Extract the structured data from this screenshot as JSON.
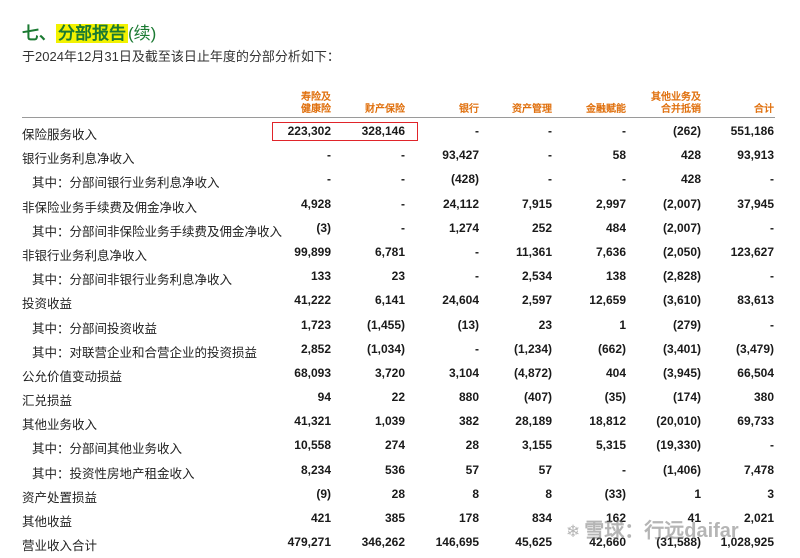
{
  "section": {
    "number": "七、",
    "title": "分部报告",
    "continued": "(续)"
  },
  "subtitle": "于2024年12月31日及截至该日止年度的分部分析如下：",
  "columns": [
    {
      "line1": "寿险及",
      "line2": "健康险"
    },
    {
      "line1": "",
      "line2": "财产保险"
    },
    {
      "line1": "",
      "line2": "银行"
    },
    {
      "line1": "",
      "line2": "资产管理"
    },
    {
      "line1": "",
      "line2": "金融赋能"
    },
    {
      "line1": "其他业务及",
      "line2": "合并抵销"
    },
    {
      "line1": "",
      "line2": "合计"
    }
  ],
  "rows": [
    {
      "label": "保险服务收入",
      "sub": false,
      "values": [
        "223,302",
        "328,146",
        "-",
        "-",
        "-",
        "(262)",
        "551,186"
      ]
    },
    {
      "label": "银行业务利息净收入",
      "sub": false,
      "values": [
        "-",
        "-",
        "93,427",
        "-",
        "58",
        "428",
        "93,913"
      ]
    },
    {
      "label": "其中：分部间银行业务利息净收入",
      "sub": true,
      "values": [
        "-",
        "-",
        "(428)",
        "-",
        "-",
        "428",
        "-"
      ]
    },
    {
      "label": "非保险业务手续费及佣金净收入",
      "sub": false,
      "values": [
        "4,928",
        "-",
        "24,112",
        "7,915",
        "2,997",
        "(2,007)",
        "37,945"
      ]
    },
    {
      "label": "其中：分部间非保险业务手续费及佣金净收入",
      "sub": true,
      "values": [
        "(3)",
        "-",
        "1,274",
        "252",
        "484",
        "(2,007)",
        "-"
      ]
    },
    {
      "label": "非银行业务利息净收入",
      "sub": false,
      "values": [
        "99,899",
        "6,781",
        "-",
        "11,361",
        "7,636",
        "(2,050)",
        "123,627"
      ]
    },
    {
      "label": "其中：分部间非银行业务利息净收入",
      "sub": true,
      "values": [
        "133",
        "23",
        "-",
        "2,534",
        "138",
        "(2,828)",
        "-"
      ]
    },
    {
      "label": "投资收益",
      "sub": false,
      "values": [
        "41,222",
        "6,141",
        "24,604",
        "2,597",
        "12,659",
        "(3,610)",
        "83,613"
      ]
    },
    {
      "label": "其中：分部间投资收益",
      "sub": true,
      "values": [
        "1,723",
        "(1,455)",
        "(13)",
        "23",
        "1",
        "(279)",
        "-"
      ]
    },
    {
      "label": "其中：对联营企业和合营企业的投资损益",
      "sub": true,
      "values": [
        "2,852",
        "(1,034)",
        "-",
        "(1,234)",
        "(662)",
        "(3,401)",
        "(3,479)"
      ]
    },
    {
      "label": "公允价值变动损益",
      "sub": false,
      "values": [
        "68,093",
        "3,720",
        "3,104",
        "(4,872)",
        "404",
        "(3,945)",
        "66,504"
      ]
    },
    {
      "label": "汇兑损益",
      "sub": false,
      "values": [
        "94",
        "22",
        "880",
        "(407)",
        "(35)",
        "(174)",
        "380"
      ]
    },
    {
      "label": "其他业务收入",
      "sub": false,
      "values": [
        "41,321",
        "1,039",
        "382",
        "28,189",
        "18,812",
        "(20,010)",
        "69,733"
      ]
    },
    {
      "label": "其中：分部间其他业务收入",
      "sub": true,
      "values": [
        "10,558",
        "274",
        "28",
        "3,155",
        "5,315",
        "(19,330)",
        "-"
      ]
    },
    {
      "label": "其中：投资性房地产租金收入",
      "sub": true,
      "values": [
        "8,234",
        "536",
        "57",
        "57",
        "-",
        "(1,406)",
        "7,478"
      ]
    },
    {
      "label": "资产处置损益",
      "sub": false,
      "values": [
        "(9)",
        "28",
        "8",
        "8",
        "(33)",
        "1",
        "3"
      ]
    },
    {
      "label": "其他收益",
      "sub": false,
      "values": [
        "421",
        "385",
        "178",
        "834",
        "162",
        "41",
        "2,021"
      ]
    },
    {
      "label": "营业收入合计",
      "sub": false,
      "values": [
        "479,271",
        "346,262",
        "146,695",
        "45,625",
        "42,660",
        "(31,588)",
        "1,028,925"
      ]
    }
  ],
  "watermark": "雪球：行远daifar",
  "colors": {
    "title_green": "#1b7a32",
    "highlight_yellow": "#f2f200",
    "header_orange": "#e0710f",
    "annotation_red": "#e0242a"
  }
}
